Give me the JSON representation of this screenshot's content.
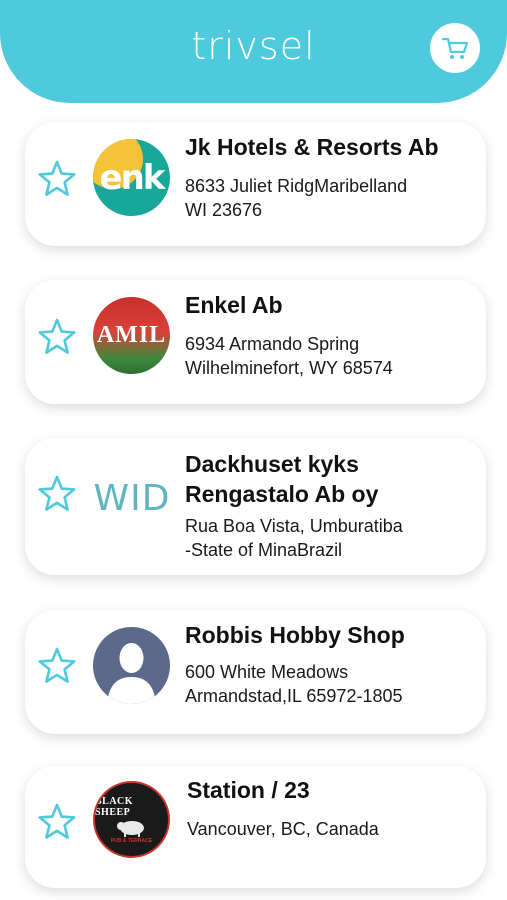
{
  "app": {
    "brand": "trivsel",
    "cart_icon": "cart-icon",
    "accent": "#4fc9dc"
  },
  "stores": [
    {
      "name": "Jk Hotels & Resorts Ab",
      "address_line1": "8633 Juliet RidgMaribelland",
      "address_line2": "WI 23676",
      "logo_text": "enk",
      "logo_icon": "enk-logo"
    },
    {
      "name": "Enkel Ab",
      "address_line1": "6934 Armando Spring",
      "address_line2": "Wilhelminefort, WY  68574",
      "logo_text": "AMIL",
      "logo_icon": "tulip-photo-logo"
    },
    {
      "name_line1": "Dackhuset kyks",
      "name_line2": "Rengastalo Ab oy",
      "address_line1": "Rua Boa Vista, Umburatiba",
      "address_line2": "-State of MinaBrazil",
      "logo_text": "WID",
      "logo_icon": "wid-logo"
    },
    {
      "name": "Robbis Hobby Shop",
      "address_line1": "600 White Meadows",
      "address_line2": "Armandstad,IL 65972-1805",
      "logo_icon": "person-avatar-icon"
    },
    {
      "name": "Station / 23",
      "address_line1": "Vancouver, BC, Canada",
      "logo_text": "BLACK SHEEP",
      "logo_subtext": "PUB & TERRACE",
      "logo_icon": "black-sheep-logo"
    }
  ]
}
